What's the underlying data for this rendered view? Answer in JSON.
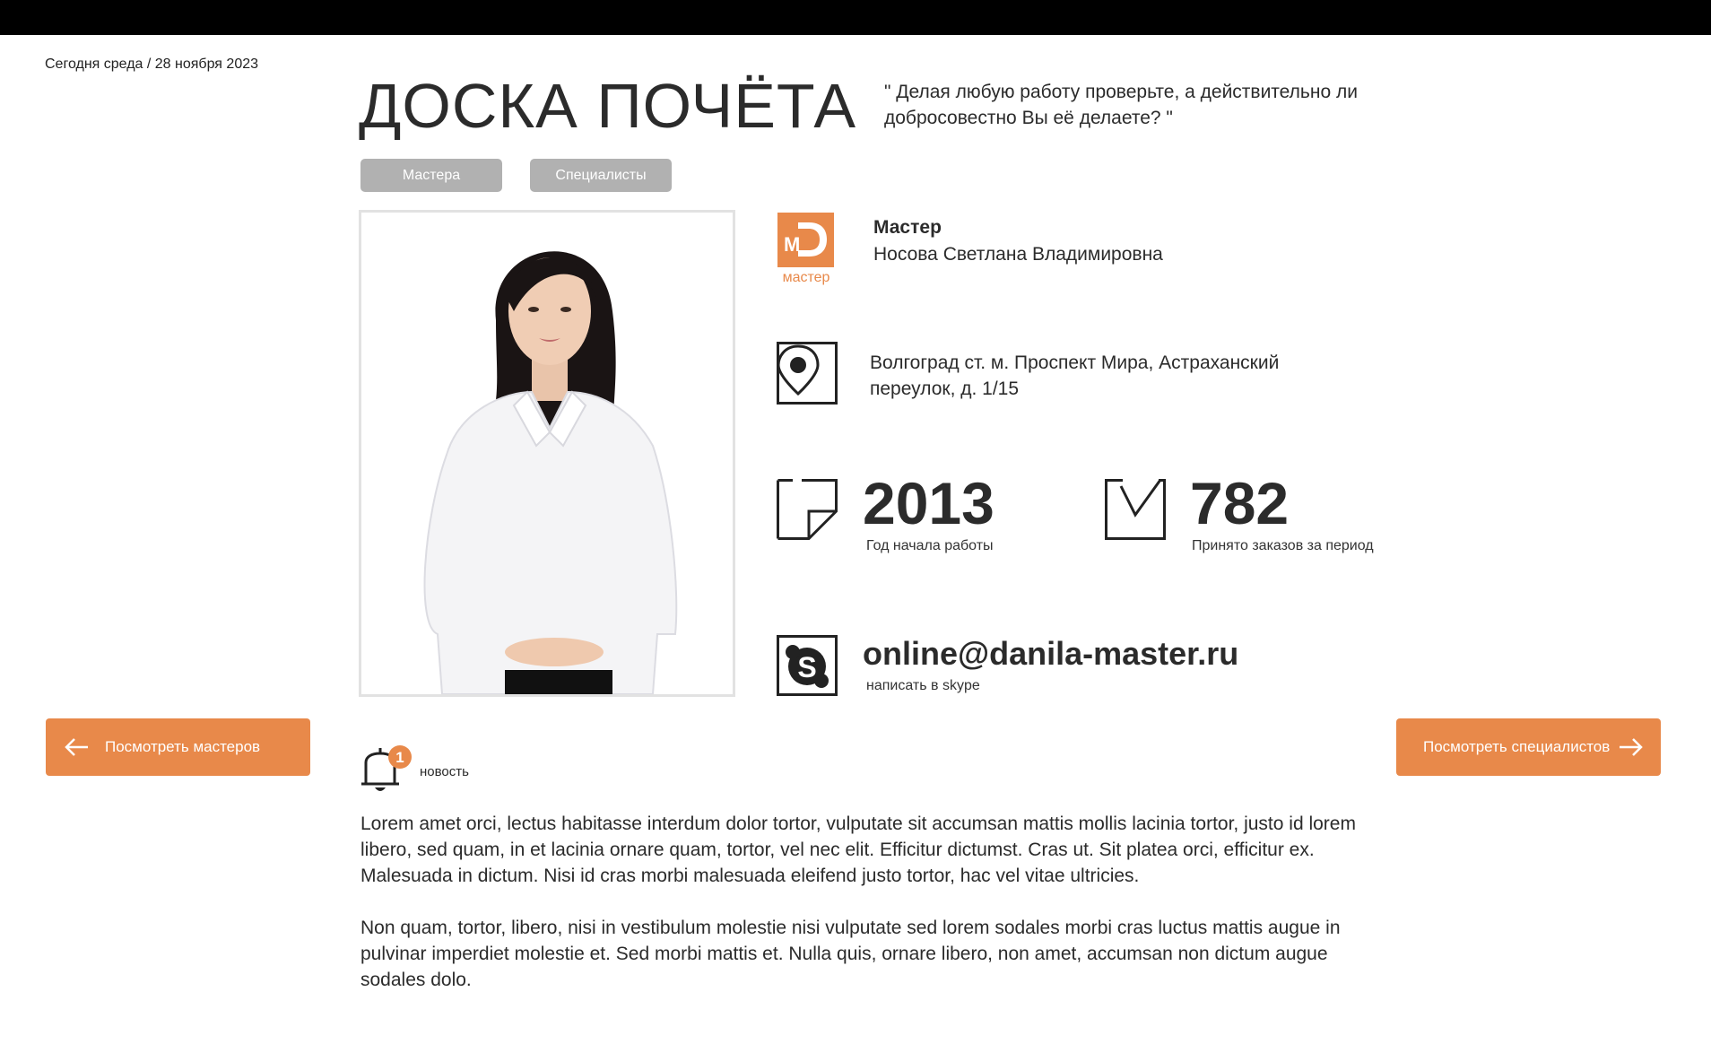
{
  "header": {
    "date": "Сегодня среда / 28 ноября 2023",
    "title": "ДОСКА ПОЧЁТА",
    "quote": "\" Делая любую работу проверьте, а действительно ли добросовестно Вы её делаете? \""
  },
  "tabs": [
    {
      "label": "Мастера"
    },
    {
      "label": "Специалисты"
    }
  ],
  "profile": {
    "logo_letters": "MD",
    "logo_caption": "мастер",
    "role": "Мастер",
    "name": "Носова Светлана Владимировна",
    "address": "Волгоград ст. м. Проспект Мира, Астраханский переулок, д. 1/15",
    "start_year": "2013",
    "start_year_caption": "Год начала работы",
    "orders": "782",
    "orders_caption": "Принято заказов за период",
    "email": "online@danila-master.ru",
    "email_caption": "написать в skype"
  },
  "nav": {
    "left_label": "Посмотреть мастеров",
    "right_label": "Посмотреть специалистов"
  },
  "news": {
    "badge_count": "1",
    "label": "новость",
    "paragraphs": [
      "Lorem amet orci, lectus habitasse interdum dolor tortor, vulputate sit accumsan mattis mollis lacinia tortor, justo id lorem libero, sed quam, in et lacinia ornare quam, tortor, vel nec elit. Efficitur dictumst. Cras ut. Sit platea orci, efficitur ex. Malesuada in dictum. Nisi id cras morbi malesuada eleifend justo tortor, hac vel vitae ultricies.",
      "Non quam, tortor, libero, nisi in vestibulum molestie nisi vulputate sed lorem sodales morbi cras luctus mattis augue in pulvinar imperdiet molestie et. Sed morbi mattis et. Nulla quis, ornare libero, non amet, accumsan non dictum augue sodales dolo."
    ]
  },
  "colors": {
    "accent": "#e8894a",
    "tab_bg": "#b1b1b1",
    "text": "#2b2b2b",
    "topbar": "#000000"
  },
  "icons": {
    "logo": "master-logo-icon",
    "location": "map-pin-icon",
    "year": "document-icon",
    "orders": "checkmark-box-icon",
    "skype": "skype-icon",
    "news": "bell-icon",
    "arrow_left": "arrow-left-icon",
    "arrow_right": "arrow-right-icon"
  }
}
